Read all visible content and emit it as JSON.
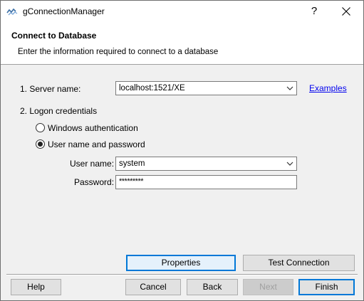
{
  "window": {
    "title": "gConnectionManager",
    "help_label": "?"
  },
  "header": {
    "title": "Connect to Database",
    "subtitle": "Enter the information required to connect to a database"
  },
  "form": {
    "server": {
      "label": "1. Server name:",
      "value": "localhost:1521/XE",
      "examples_link": "Examples"
    },
    "logon": {
      "label": "2. Logon credentials",
      "options": [
        "Windows authentication",
        "User name and password"
      ],
      "selected_index": 1
    },
    "username": {
      "label": "User name:",
      "value": "system"
    },
    "password": {
      "label": "Password:",
      "value": "*********"
    }
  },
  "buttons": {
    "properties": "Properties",
    "test_connection": "Test Connection",
    "help": "Help",
    "cancel": "Cancel",
    "back": "Back",
    "next": "Next",
    "finish": "Finish"
  }
}
